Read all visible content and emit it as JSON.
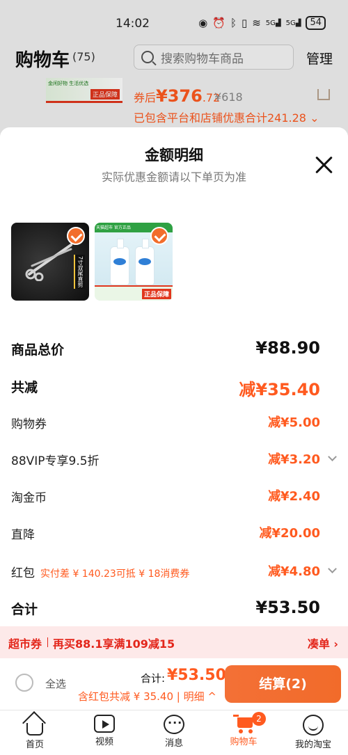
{
  "status_bar": {
    "time": "14:02",
    "signal_1": "5G",
    "signal_2": "5G",
    "battery": "54"
  },
  "cart_header": {
    "title": "购物车",
    "count": "(75)",
    "search_placeholder": "搜索购物车商品",
    "manage": "管理"
  },
  "cart_promo": {
    "thumb_text": "金闲好物 生活优选",
    "thumb_badge": "正品保障",
    "after_coupon_label": "券后",
    "after_coupon_int": "¥376",
    "after_coupon_dec": ".72",
    "original_price": "¥618",
    "discount_note": "已包含平台和店铺优惠合计241.28"
  },
  "sheet": {
    "title": "金额明细",
    "subtitle": "实际优惠金额请以下单页为准",
    "products": [
      {
        "name": "scissors",
        "tag": "7寸双尾直剪"
      },
      {
        "name": "body-wash",
        "top_text": "天猫超市 官方正品",
        "badge": "正品保障"
      }
    ],
    "rows": {
      "total_price": {
        "label": "商品总价",
        "value": "¥88.90"
      },
      "total_reduce": {
        "label": "共减",
        "value": "减¥35.40"
      },
      "coupon": {
        "label": "购物券",
        "value": "减¥5.00"
      },
      "vip": {
        "label": "88VIP专享9.5折",
        "value": "减¥3.20"
      },
      "taojinbi": {
        "label": "淘金币",
        "value": "减¥2.40"
      },
      "direct": {
        "label": "直降",
        "value": "减¥20.00"
      },
      "redpacket": {
        "label": "红包",
        "note": "实付差 ¥ 140.23可抵 ¥ 18消费券",
        "value": "减¥4.80"
      },
      "sum": {
        "label": "合计",
        "value": "¥53.50"
      }
    }
  },
  "coupon_bar": {
    "label": "超市券",
    "text": "再买88.1享满109减15",
    "link": "凑单"
  },
  "bottom_bar": {
    "select_all": "全选",
    "total_label": "合计:",
    "total_value": "¥53.50",
    "sub_text": "含红包共减 ¥ 35.40 | 明细",
    "checkout": "结算(2)"
  },
  "tabbar": {
    "tabs": [
      {
        "label": "首页",
        "icon": "home-icon"
      },
      {
        "label": "视频",
        "icon": "video-icon"
      },
      {
        "label": "消息",
        "icon": "message-icon"
      },
      {
        "label": "购物车",
        "icon": "cart-icon",
        "badge": "2",
        "active": true
      },
      {
        "label": "我的淘宝",
        "icon": "profile-icon"
      }
    ]
  },
  "colors": {
    "accent": "#ff5a1f",
    "checkout": "#f26b2a",
    "coupon_red": "#e3261b",
    "coupon_bg": "#fde9e9"
  }
}
